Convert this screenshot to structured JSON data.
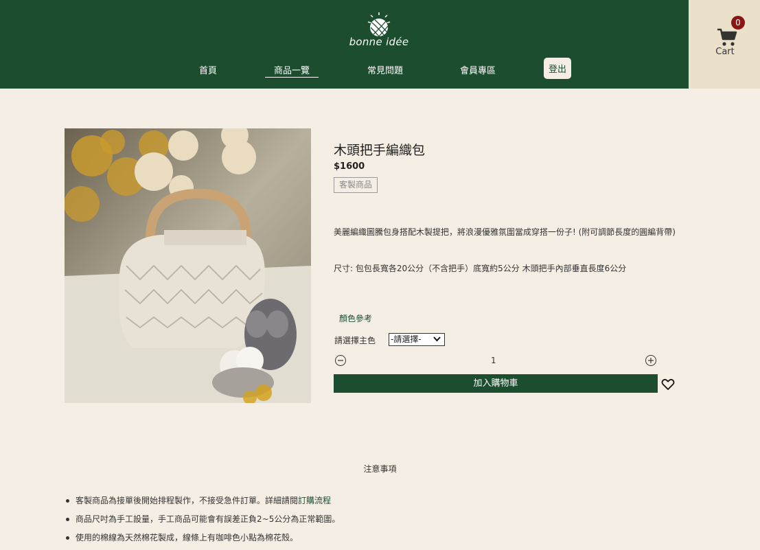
{
  "brand": {
    "logo_text": "bonne idée"
  },
  "nav": {
    "items": [
      {
        "label": "首頁"
      },
      {
        "label": "商品一覽"
      },
      {
        "label": "常見問題"
      },
      {
        "label": "會員專區"
      }
    ],
    "logout_label": "登出"
  },
  "cart": {
    "count": "0",
    "label": "Cart"
  },
  "product": {
    "title": "木頭把手編織包",
    "price": "$1600",
    "tag": "客製商品",
    "description": "美麗編織圖騰包身搭配木製提把，將浪漫優雅氛圍當成穿搭一份子! (附可調節長度的圓編背帶)",
    "size_text": "尺寸: 包包長寬各20公分（不含把手）底寬約5公分 木頭把手內部垂直長度6公分",
    "color_ref_label": "顏色參考",
    "select_label": "請選擇主色",
    "select_value": "-請選擇-",
    "quantity": "1",
    "add_to_cart_label": "加入購物車"
  },
  "notes": {
    "title": "注意事項",
    "items": [
      {
        "text": "客製商品為接單後開始排程製作，不接受急件訂單。詳細請閱",
        "link": "訂購流程"
      },
      {
        "text": "商品尺吋為手工設量，手工商品可能會有誤差正負2~5公分為正常範圍。"
      },
      {
        "text": "使用的棉線為天然棉花製成，線條上有咖啡色小點為棉花殼。"
      }
    ]
  },
  "colors": {
    "brand_green": "#1b4d2e",
    "page_bg": "#f5eee4",
    "cart_bg": "#ebe1ca",
    "badge_red": "#8b1414"
  }
}
